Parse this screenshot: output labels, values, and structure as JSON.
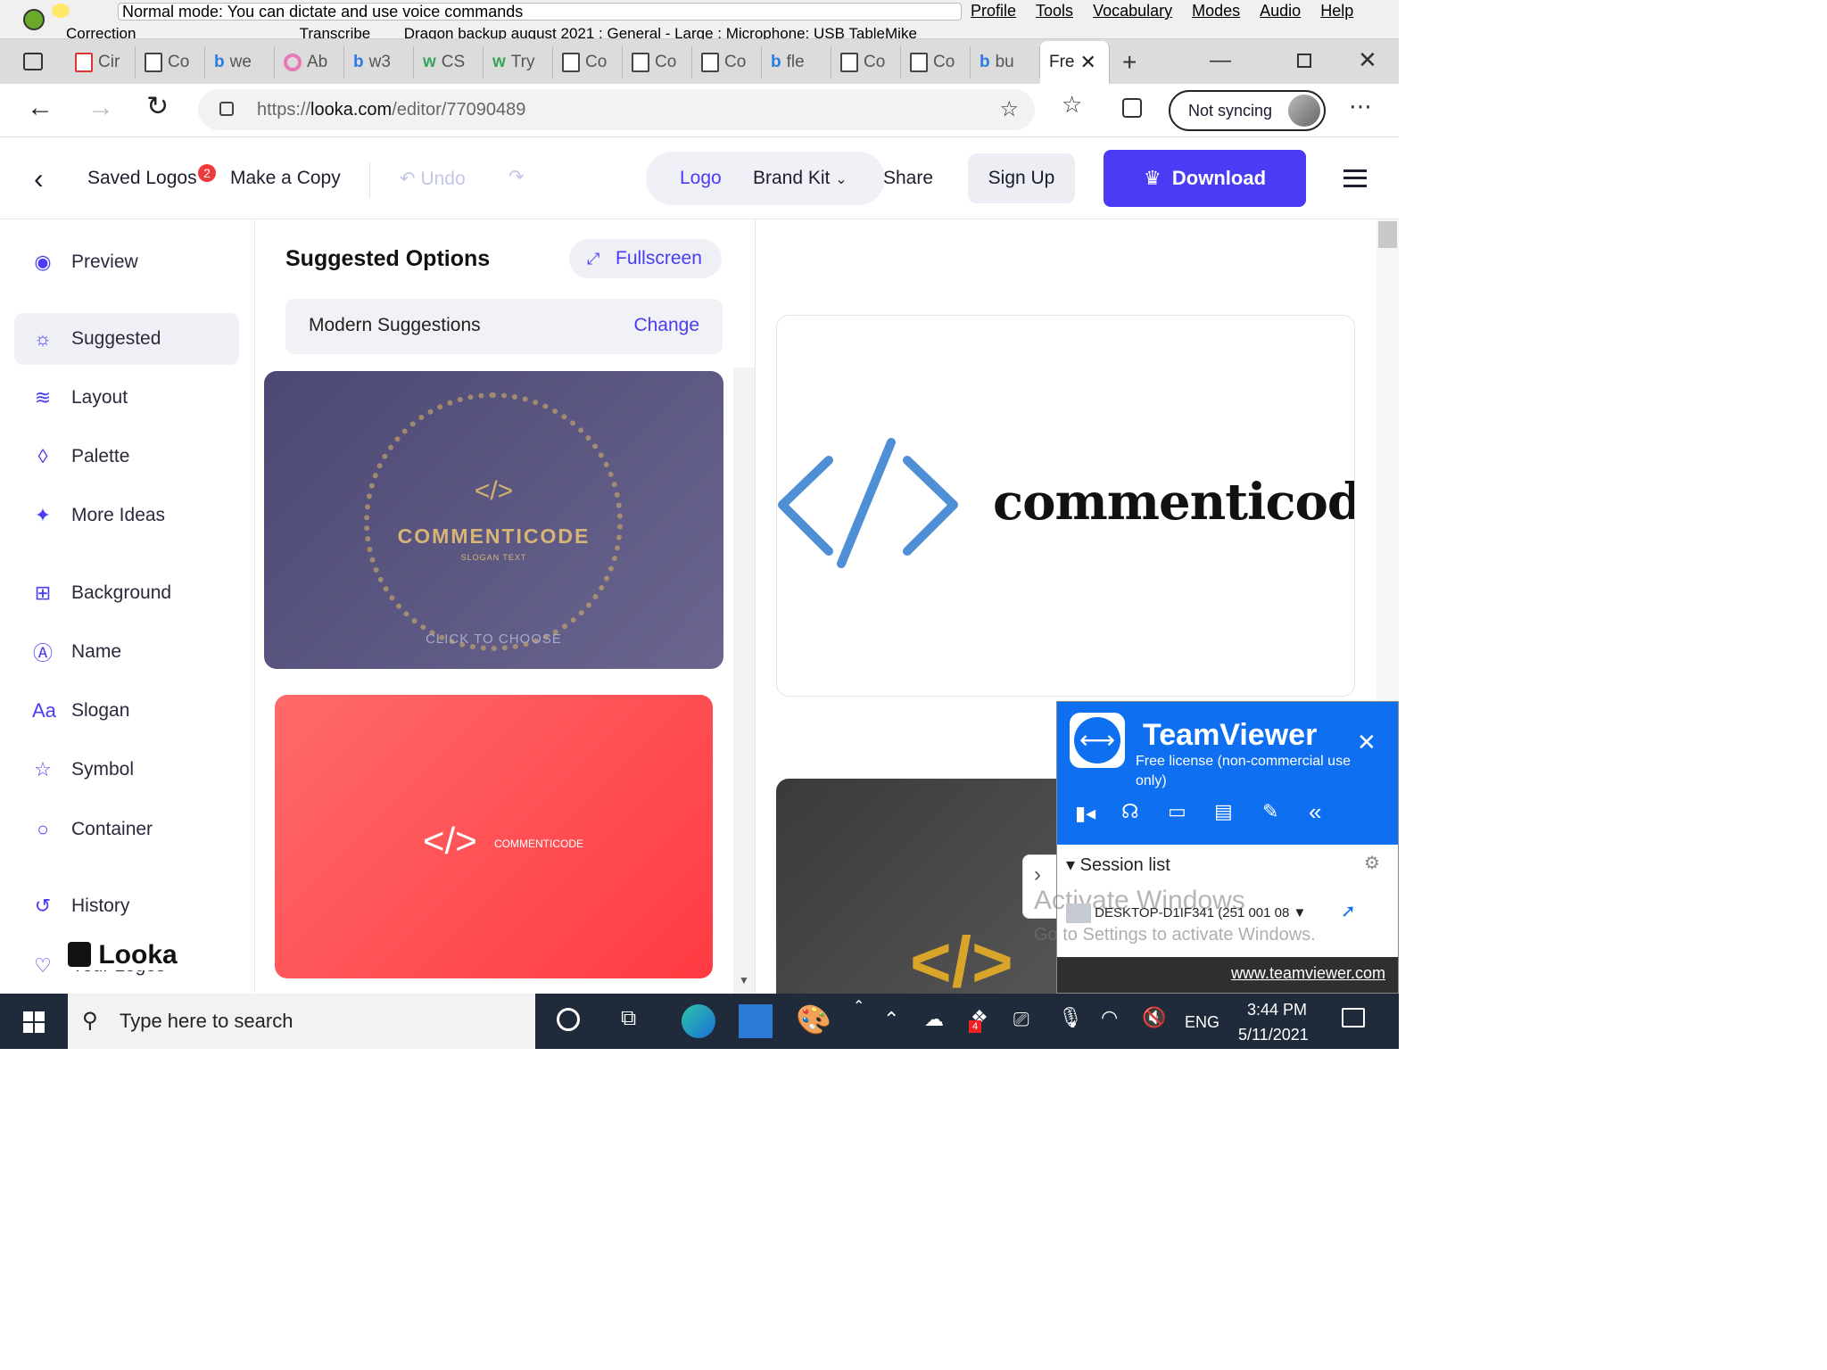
{
  "dragon": {
    "status": "Normal mode: You can dictate and use voice commands",
    "menu": [
      "Profile",
      "Tools",
      "Vocabulary",
      "Modes",
      "Audio",
      "Help"
    ],
    "correction": "Correction",
    "transcribe": "Transcribe",
    "profile_info": "Dragon backup august 2021 : General - Large : Microphone: USB TableMike"
  },
  "browser": {
    "tabs": [
      "Cir",
      "Co",
      "we",
      "Ab",
      "w3",
      "CS",
      "Try",
      "Co",
      "Co",
      "Co",
      "fle",
      "Co",
      "Co",
      "bu"
    ],
    "active_tab": "Fre",
    "url_prefix": "https://",
    "url_domain": "looka.com",
    "url_path": "/editor/77090489",
    "sync_label": "Not syncing"
  },
  "app_header": {
    "saved_logos": "Saved Logos",
    "saved_badge": "2",
    "make_copy": "Make a Copy",
    "undo": "Undo",
    "seg_logo": "Logo",
    "seg_brand": "Brand Kit",
    "share": "Share",
    "signup": "Sign Up",
    "download": "Download"
  },
  "sidebar": {
    "items": [
      {
        "label": "Preview",
        "icon": "eye-icon"
      },
      {
        "label": "Suggested",
        "icon": "bulb-icon"
      },
      {
        "label": "Layout",
        "icon": "layers-icon"
      },
      {
        "label": "Palette",
        "icon": "drop-icon"
      },
      {
        "label": "More Ideas",
        "icon": "wand-icon"
      },
      {
        "label": "Background",
        "icon": "background-icon"
      },
      {
        "label": "Name",
        "icon": "name-icon"
      },
      {
        "label": "Slogan",
        "icon": "slogan-icon"
      },
      {
        "label": "Symbol",
        "icon": "star-icon"
      },
      {
        "label": "Container",
        "icon": "circle-icon"
      },
      {
        "label": "History",
        "icon": "history-icon"
      },
      {
        "label": "Your Logos",
        "icon": "heart-icon"
      }
    ],
    "brand": "Looka"
  },
  "suggestions": {
    "title": "Suggested Options",
    "fullscreen": "Fullscreen",
    "category": "Modern Suggestions",
    "change": "Change",
    "card1_name": "COMMENTICODE",
    "card1_slogan": "SLOGAN TEXT",
    "card1_hint": "CLICK TO CHOOSE",
    "card2_name": "COMMENTICODE"
  },
  "preview": {
    "logo_name": "commenticode",
    "colors": {
      "accent": "#4a3cf4",
      "symbol_blue": "#4f8fd6",
      "card_red": "#ff4549",
      "card_purple": "#56537e"
    }
  },
  "teamviewer": {
    "title": "TeamViewer",
    "license": "Free license (non-commercial use only)",
    "session_list": "Session list",
    "device": "DESKTOP-D1IF341 (251 001 08",
    "link": "www.teamviewer.com",
    "watermark_1": "Activate Windows",
    "watermark_2": "Go to Settings to activate Windows."
  },
  "taskbar": {
    "search_placeholder": "Type here to search",
    "lang": "ENG",
    "time": "3:44 PM",
    "date": "5/11/2021",
    "dropbox_badge": "4"
  }
}
